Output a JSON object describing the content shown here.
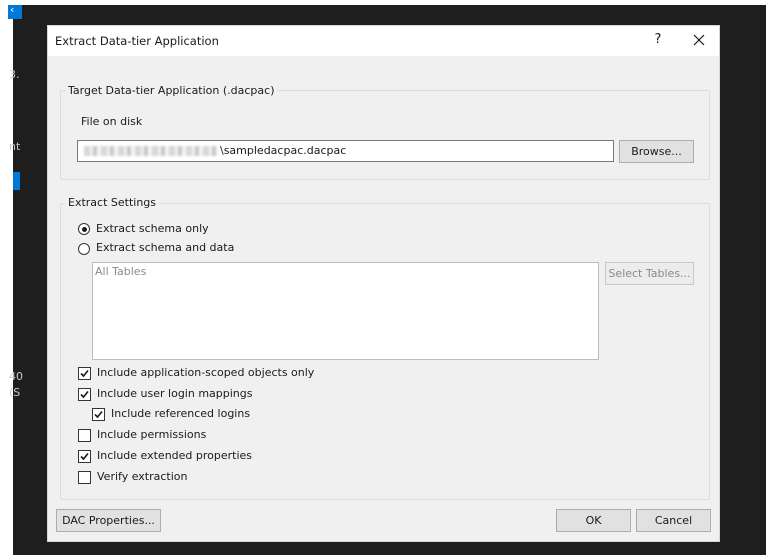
{
  "background": {
    "fragments": [
      "3.",
      "nt",
      "40",
      "(S"
    ]
  },
  "dialog": {
    "title": "Extract Data-tier Application",
    "help_symbol": "?",
    "target_group": {
      "label": "Target Data-tier Application (.dacpac)",
      "file_label": "File on disk",
      "file_value": "\\sampledacpac.dacpac",
      "browse_label": "Browse..."
    },
    "settings_group": {
      "label": "Extract Settings",
      "radio_schema_only": {
        "label": "Extract schema only",
        "selected": true
      },
      "radio_schema_data": {
        "label": "Extract schema and data",
        "selected": false
      },
      "tables_placeholder": "All Tables",
      "select_tables_label": "Select Tables...",
      "options": [
        {
          "label": "Include application-scoped objects only",
          "checked": true
        },
        {
          "label": "Include user login mappings",
          "checked": true
        },
        {
          "label": "Include referenced logins",
          "checked": true
        },
        {
          "label": "Include permissions",
          "checked": false
        },
        {
          "label": "Include extended properties",
          "checked": true
        },
        {
          "label": "Verify extraction",
          "checked": false
        }
      ]
    },
    "footer": {
      "dac_properties_label": "DAC Properties...",
      "ok_label": "OK",
      "cancel_label": "Cancel"
    }
  }
}
